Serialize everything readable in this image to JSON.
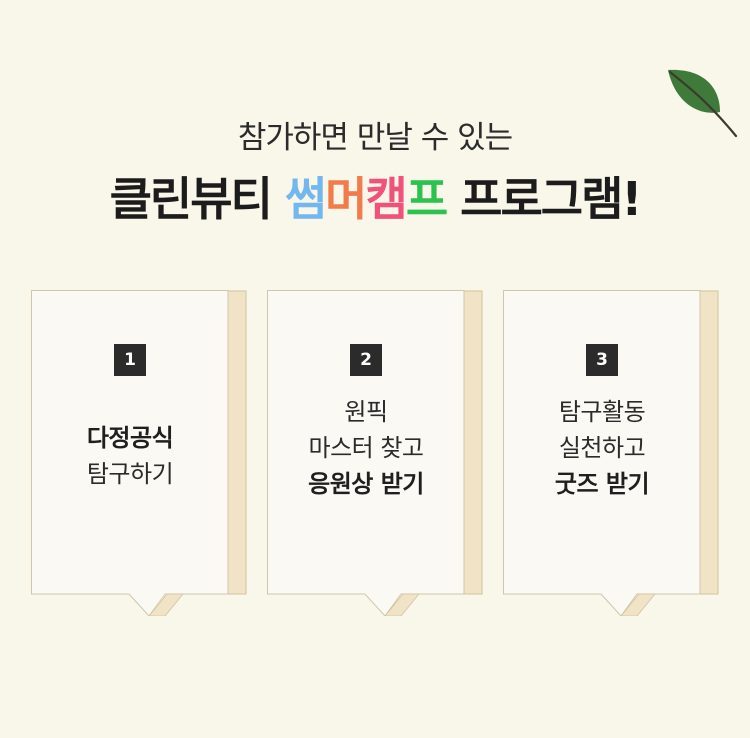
{
  "header": {
    "subtitle": "참가하면 만날 수 있는",
    "title_parts": [
      {
        "text": "클린뷰티",
        "color": "#1c1c1c"
      },
      {
        "text": "썸",
        "color": "#72b8ee"
      },
      {
        "text": "머",
        "color": "#f17b4a"
      },
      {
        "text": "캠",
        "color": "#f0527a"
      },
      {
        "text": "프",
        "color": "#2cc24f"
      },
      {
        "text": "프로그램!",
        "color": "#1c1c1c"
      }
    ]
  },
  "colors": {
    "background": "#f9f6ea",
    "card": "#fbf9f3",
    "card_edge": "#f1e4c6",
    "badge": "#2b2b2b",
    "leaf": "#3f7a3b"
  },
  "decor": {
    "leaf_icon": "leaf-icon"
  },
  "cards": [
    {
      "number": "1",
      "lines": [
        {
          "text": "다정공식",
          "bold": true
        },
        {
          "text": "탐구하기",
          "bold": false
        }
      ]
    },
    {
      "number": "2",
      "lines": [
        {
          "text": "원픽",
          "bold": false
        },
        {
          "text": "마스터 찾고",
          "bold": false
        },
        {
          "text": "응원상 받기",
          "bold": true
        }
      ]
    },
    {
      "number": "3",
      "lines": [
        {
          "text": "탐구활동",
          "bold": false
        },
        {
          "text": "실천하고",
          "bold": false
        },
        {
          "text": "굿즈 받기",
          "bold": true
        }
      ]
    }
  ]
}
